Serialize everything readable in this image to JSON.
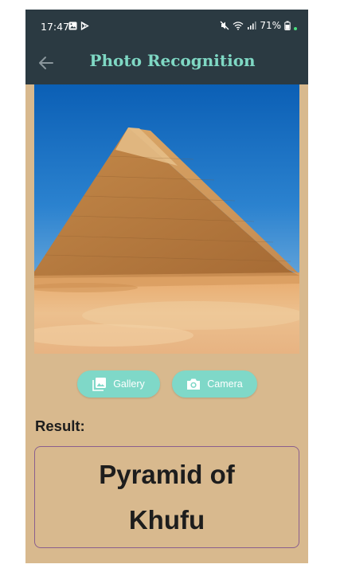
{
  "status_bar": {
    "time": "17:47",
    "battery": "71%",
    "icons_left": [
      "gallery-notification-icon",
      "play-store-icon"
    ],
    "icons_right": [
      "mute-icon",
      "wifi-icon",
      "signal-icon",
      "battery-icon"
    ],
    "dot_color": "#4ade80"
  },
  "app_bar": {
    "title": "Photo Recognition",
    "back_icon": "arrow-left-icon",
    "background": "#2b3a42",
    "title_color": "#7fd8c4"
  },
  "photo": {
    "subject": "pyramid-image"
  },
  "buttons": {
    "gallery_label": "Gallery",
    "gallery_icon": "image-library-icon",
    "camera_label": "Camera",
    "camera_icon": "camera-icon",
    "color": "#7fd8c8"
  },
  "result": {
    "label": "Result:",
    "value": "Pyramid of Khufu"
  },
  "colors": {
    "page_background": "#d8b98e",
    "result_border": "#8a5f8e"
  }
}
